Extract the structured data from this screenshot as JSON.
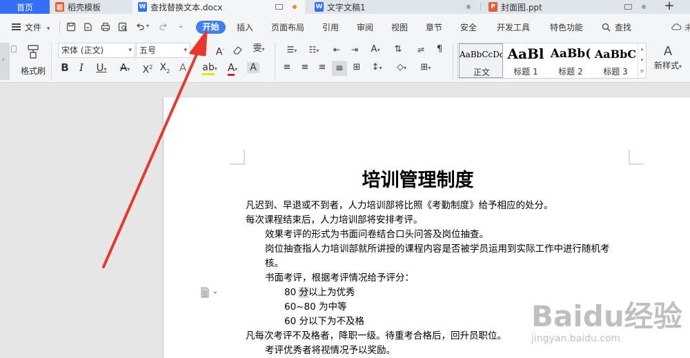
{
  "tabs": {
    "home": "首页",
    "t1": "稻壳模板",
    "t2": "查找替换文本.docx",
    "t3": "文字文稿1",
    "t4": "封面图.ppt",
    "new_tab": "+"
  },
  "menu": {
    "file": "文件",
    "start": "开始",
    "insert": "插入",
    "layout": "页面布局",
    "reference": "引用",
    "review": "审阅",
    "view": "视图",
    "chapter": "章节",
    "security": "安全",
    "dev": "开发工具",
    "special": "特色功能",
    "search": "查找",
    "unsaved": "未"
  },
  "ribbon": {
    "format_painter": "格式刷",
    "font_name": "宋体 (正文)",
    "font_size": "五号",
    "styles": [
      {
        "sample": "AaBbCcDd",
        "name": "正文"
      },
      {
        "sample": "AaBl",
        "name": "标题 1"
      },
      {
        "sample": "AaBb(",
        "name": "标题 2"
      },
      {
        "sample": "AaBbC",
        "name": "标题 3"
      }
    ],
    "new_style": "新样式"
  },
  "document": {
    "title": "培训管理制度",
    "lines": [
      "凡迟到、早退或不到者，人力培训部将比照《考勤制度》给予相应的处分。",
      "每次课程结束后，人力培训部将安排考评。",
      "效果考评的形式为书面问卷结合口头问答及岗位抽查。",
      "岗位抽查指人力培训部就所讲授的课程内容是否被学员运用到实际工作中进行随机考",
      "核。",
      "书面考评，根据考评情况给予评分：",
      "80 ",
      "分",
      "以上为优秀",
      "60~80 为中等",
      "60 分以下为不及格",
      "凡每次考评不及格者，降职一级。待重考合格后，回升员职位。",
      "考评优秀者将视情况予以奖励。"
    ]
  },
  "watermark": {
    "brand": "Baidu经验",
    "url": "jingyan.baidu.com"
  },
  "colors": {
    "accent": "#3f7ef5",
    "annotation": "#e8372f"
  }
}
